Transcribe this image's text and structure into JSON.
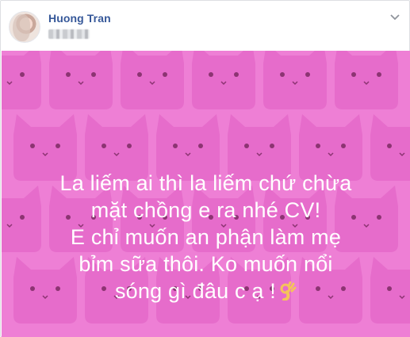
{
  "post": {
    "author": "Huong Tran",
    "privacy_icon": "blurred-timestamp",
    "menu_icon": "chevron-down-icon"
  },
  "status": {
    "lines": [
      "La liếm ai thì la liếm chứ chừa",
      "mặt chồng e ra nhé CV!",
      "E chỉ muốn an phận làm mẹ",
      "bỉm sữa thôi. Ko muốn nổi",
      "sóng gì đâu c ạ !"
    ],
    "emoji": "ok-hand-icon"
  },
  "colors": {
    "background": "#ee7fd5",
    "pattern": "#e168c6",
    "text": "#ffffff",
    "author": "#365899"
  }
}
